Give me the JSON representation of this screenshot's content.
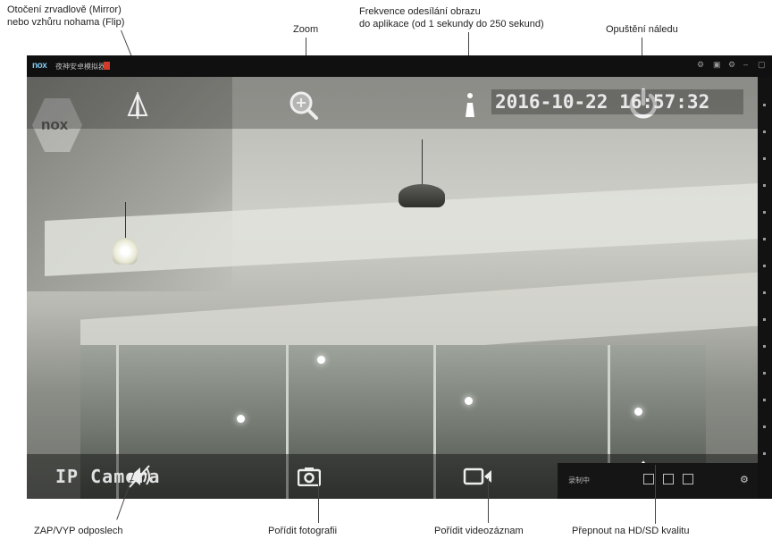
{
  "annotations": {
    "mirror_flip": [
      "Otočení zrvadlově (Mirror)",
      "nebo vzhůru nohama (Flip)"
    ],
    "zoom": "Zoom",
    "frequency": [
      "Frekvence odesílání obrazu",
      "do aplikace (od 1 sekundy do 250 sekund)"
    ],
    "exit_hint": "Opuštění náledu",
    "listen": "ZAP/VYP odposlech",
    "photo": "Pořídit fotografii",
    "video_record": "Pořídit videozáznam",
    "quality": "Přepnout na HD/SD kvalitu"
  },
  "window": {
    "logo": "nox",
    "title": "夜神安卓模拟器",
    "controls": [
      "⚙",
      "▣",
      "⚙",
      "–",
      "▢"
    ]
  },
  "camera": {
    "timestamp": "2016-10-22 16:57:32",
    "label": "IP Camera",
    "watermark": "nox"
  },
  "recording": {
    "label": "录制中"
  },
  "icons": {
    "mirror": "mirror-flip-icon",
    "zoom": "zoom-icon",
    "frequency": "frequency-icon",
    "power": "power-icon",
    "speaker": "speaker-mute-icon",
    "camera": "camera-icon",
    "video": "video-camera-icon",
    "quality": "quality-switch-icon"
  }
}
